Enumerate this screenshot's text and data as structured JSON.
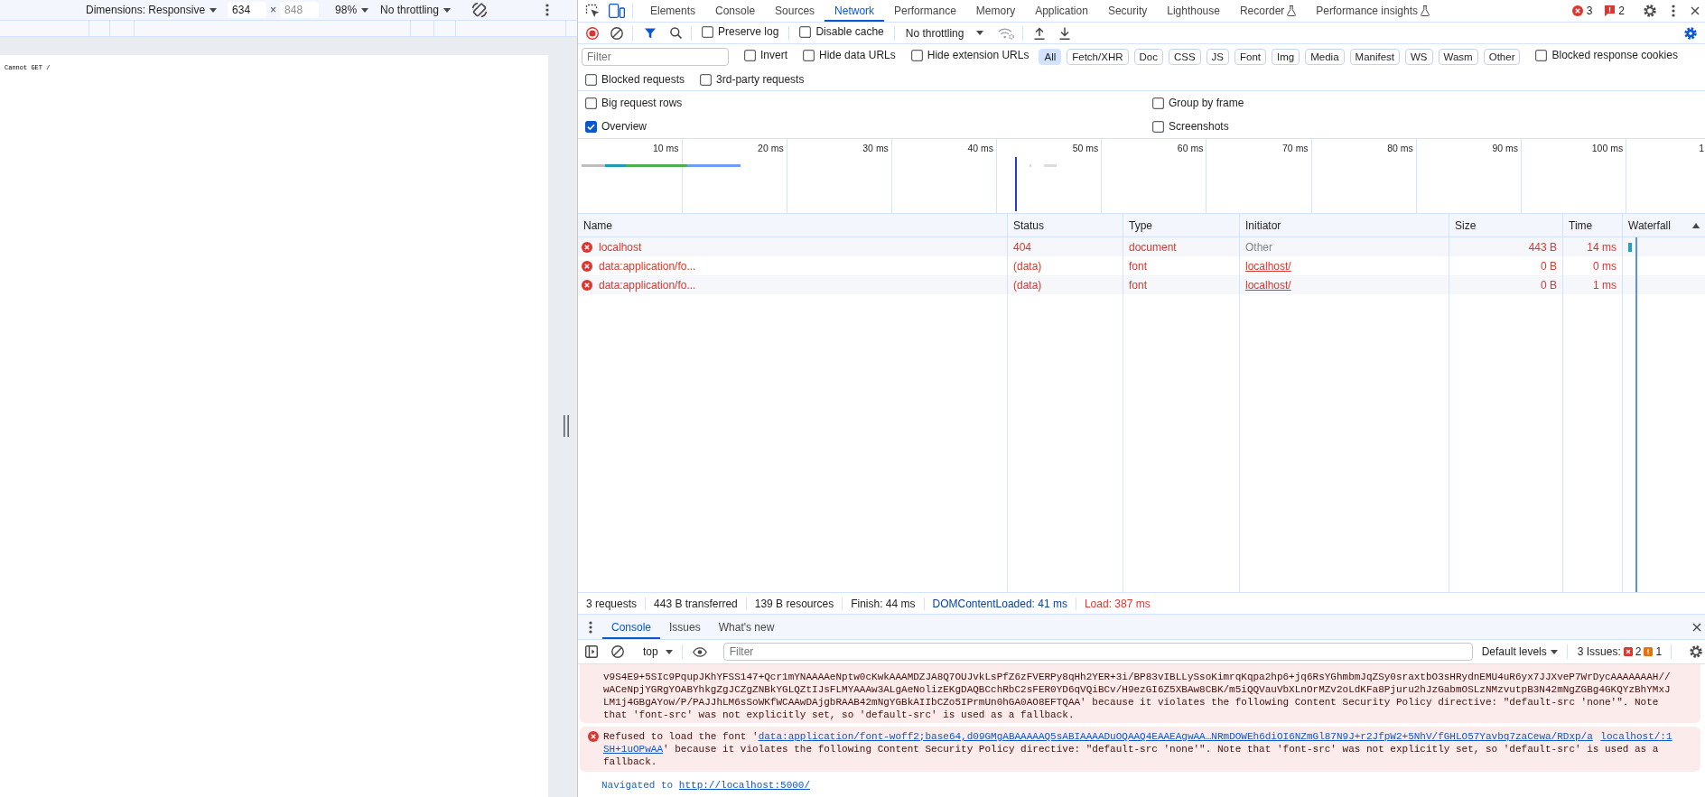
{
  "device_toolbar": {
    "dimensions": "Dimensions: Responsive",
    "width_field": {
      "value": "634"
    },
    "x_sign": "×",
    "height_field": {
      "placeholder": "848"
    },
    "zoom": "98%",
    "throttling": "No throttling"
  },
  "page": {
    "text": "Cannot GET /"
  },
  "devtools": {
    "device_mode_on": true,
    "tabs": [
      {
        "label": "Elements",
        "selected": false,
        "experimental": false
      },
      {
        "label": "Console",
        "selected": false,
        "experimental": false
      },
      {
        "label": "Sources",
        "selected": false,
        "experimental": false
      },
      {
        "label": "Network",
        "selected": true,
        "experimental": false
      },
      {
        "label": "Performance",
        "selected": false,
        "experimental": false
      },
      {
        "label": "Memory",
        "selected": false,
        "experimental": false
      },
      {
        "label": "Application",
        "selected": false,
        "experimental": false
      },
      {
        "label": "Security",
        "selected": false,
        "experimental": false
      },
      {
        "label": "Lighthouse",
        "selected": false,
        "experimental": false
      },
      {
        "label": "Recorder",
        "selected": false,
        "experimental": true
      },
      {
        "label": "Performance insights",
        "selected": false,
        "experimental": true
      }
    ],
    "error_count": "3",
    "issue_count": "2"
  },
  "network": {
    "toolbar": {
      "recording": true,
      "filter_bar_open": true,
      "checkboxes": [
        {
          "label": "Preserve log",
          "checked": false
        },
        {
          "label": "Disable cache",
          "checked": false
        }
      ],
      "throttling": "No throttling",
      "settings_open": true
    },
    "filter_bar": {
      "placeholder": "Filter",
      "checkboxes": [
        {
          "label": "Invert",
          "checked": false
        },
        {
          "label": "Hide data URLs",
          "checked": false
        },
        {
          "label": "Hide extension URLs",
          "checked": false
        }
      ],
      "types": [
        {
          "label": "All",
          "selected": true
        },
        {
          "label": "Fetch/XHR",
          "selected": false
        },
        {
          "label": "Doc",
          "selected": false
        },
        {
          "label": "CSS",
          "selected": false
        },
        {
          "label": "JS",
          "selected": false
        },
        {
          "label": "Font",
          "selected": false
        },
        {
          "label": "Img",
          "selected": false
        },
        {
          "label": "Media",
          "selected": false
        },
        {
          "label": "Manifest",
          "selected": false
        },
        {
          "label": "WS",
          "selected": false
        },
        {
          "label": "Wasm",
          "selected": false
        },
        {
          "label": "Other",
          "selected": false
        }
      ],
      "more_checkboxes": [
        {
          "label": "Blocked response cookies",
          "checked": false
        }
      ]
    },
    "request_filters": [
      {
        "label": "Blocked requests",
        "checked": false
      },
      {
        "label": "3rd-party requests",
        "checked": false
      }
    ],
    "settings": {
      "left": [
        {
          "label": "Big request rows",
          "checked": false
        },
        {
          "label": "Overview",
          "checked": true
        }
      ],
      "right": [
        {
          "label": "Group by frame",
          "checked": false
        },
        {
          "label": "Screenshots",
          "checked": false
        }
      ]
    },
    "overview": {
      "ticks": [
        "10 ms",
        "20 ms",
        "30 ms",
        "40 ms",
        "50 ms",
        "60 ms",
        "70 ms",
        "80 ms",
        "90 ms",
        "100 ms",
        "1"
      ]
    },
    "table": {
      "columns": [
        {
          "label": "Name",
          "sorted": false
        },
        {
          "label": "Status",
          "sorted": false
        },
        {
          "label": "Type",
          "sorted": false
        },
        {
          "label": "Initiator",
          "sorted": false
        },
        {
          "label": "Size",
          "sorted": false
        },
        {
          "label": "Time",
          "sorted": false
        },
        {
          "label": "Waterfall",
          "sorted": true
        }
      ],
      "rows": [
        {
          "name": "localhost",
          "failed": true,
          "status": "404",
          "type": "document",
          "initiator": {
            "text": "Other",
            "link": false
          },
          "size": "443 B",
          "time": "14 ms"
        },
        {
          "name": "data:application/fo...",
          "failed": true,
          "status": "(data)",
          "type": "font",
          "initiator": {
            "text": "localhost/",
            "link": true
          },
          "size": "0 B",
          "time": "0 ms"
        },
        {
          "name": "data:application/fo...",
          "failed": true,
          "status": "(data)",
          "type": "font",
          "initiator": {
            "text": "localhost/",
            "link": true
          },
          "size": "0 B",
          "time": "1 ms"
        }
      ]
    },
    "status_bar": [
      {
        "text": "3 requests",
        "kind": "plain"
      },
      {
        "text": "443 B transferred",
        "kind": "plain"
      },
      {
        "text": "139 B resources",
        "kind": "plain"
      },
      {
        "text": "Finish: 44 ms",
        "kind": "plain"
      },
      {
        "text": "DOMContentLoaded: 41 ms",
        "kind": "dom"
      },
      {
        "text": "Load: 387 ms",
        "kind": "load"
      }
    ]
  },
  "drawer": {
    "tabs": [
      {
        "label": "Console",
        "selected": true
      },
      {
        "label": "Issues",
        "selected": false
      },
      {
        "label": "What's new",
        "selected": false
      }
    ],
    "toolbar": {
      "context": "top",
      "filter_placeholder": "Filter",
      "levels": "Default levels",
      "issues_label": "3 Issues:",
      "error_issues": "2",
      "warning_issues": "1"
    },
    "messages": [
      {
        "kind": "error",
        "cut": true,
        "url": "v9S4E9+5SIc9PqupJKhYFSS147+Qcr1mYNAAAAeNptw0cKwkAAAMDZJA8Q7OUJvkLsPfZ6zFVERPy8qHh2YER+3i/BP83vIBLLySsoKimrqKqpa2hp6+jq6RsYGhmbmJqZSy0sraxtbO3sHRydnEMU4uR6yx7JJXveP7WrDycAAAAAAAH//wACeNpjYGRgYOABYhkgZgJCZgZNBkYGLQZtIJsFLMYAAAw3ALgAeNolizEKgDAQBCchRbC2sFER0YD6qVQiBCv/H9ezGI6Z5XBAw8CBK/m5iQQVauVbXLnOrMZv2oLdKFa8Pjuru2hJzGabmOSLzNMzvutpB3N42mNgZGBg4GKQYzBhYMxJLM1j4GBgAYow/P/PAJJhLM6sSoWKfWCAAwDAjgbRAAB42mNgYGBkAIIbCZo5IPrmUn0hGA0AO8EFTQAA",
        "text": "' because it violates the following Content Security Policy directive: \"default-src 'none'\". Note that 'font-src' was not explicitly set, so 'default-src' is used as a fallback."
      },
      {
        "kind": "error",
        "cut": false,
        "prefix": "Refused to load the font '",
        "link": "data:application/font-woff2;base64,d09GMgABAAAAAQ5sABIAAAADuOQAAQ4EAAEAgwAA…NRmDOWEh6diOI6NZmGl87N9J+r2JfpW2+5NhV/fGHLO57Yavbq7zaCewa/RDxp/a",
        "source": "localhost/:1",
        "link_rest": "SH+1uOPwAA",
        "text": "' because it violates the following Content Security Policy directive: \"default-src 'none'\". Note that 'font-src' was not explicitly set, so 'default-src' is used as a fallback."
      },
      {
        "kind": "info",
        "prefix": "Navigated to",
        "link": "http://localhost:5000/"
      }
    ]
  }
}
